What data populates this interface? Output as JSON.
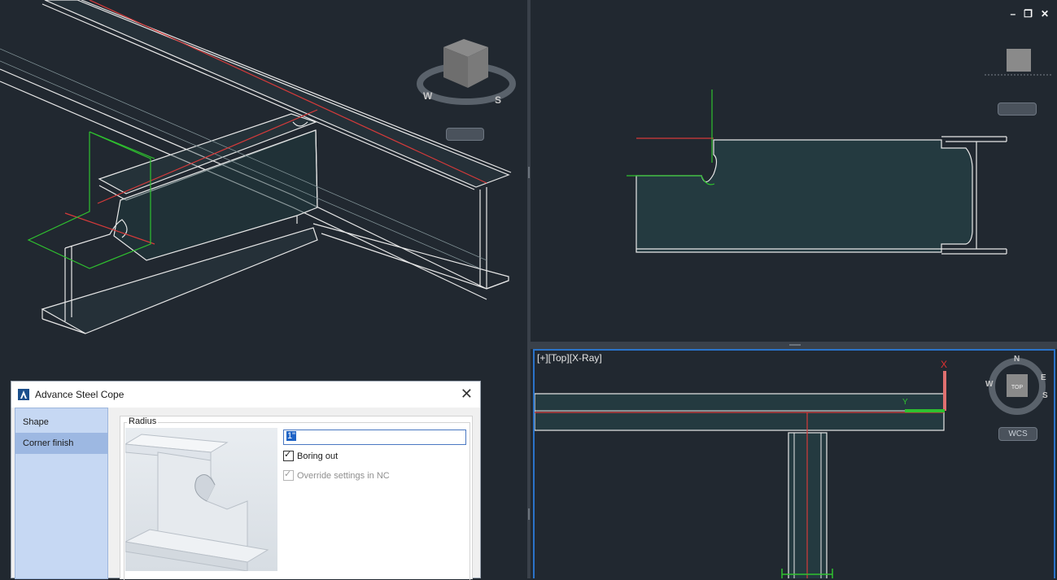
{
  "viewports": {
    "left": {
      "navcube": {
        "compass": [
          "W",
          "S"
        ]
      }
    },
    "right_top": {
      "window_controls": [
        "–",
        "❐",
        "✕"
      ]
    },
    "right_bottom": {
      "label": "[+][Top][X-Ray]",
      "navcube": {
        "face": "TOP",
        "compass": [
          "N",
          "E",
          "S",
          "W"
        ]
      },
      "wcs_label": "WCS",
      "ucs": {
        "x": "X",
        "y": "Y"
      }
    }
  },
  "dialog": {
    "title": "Advance Steel  Cope",
    "close": "✕",
    "nav": [
      "Shape",
      "Corner finish"
    ],
    "active_nav": "Corner finish",
    "group_title": "Radius",
    "radius_value": "1\"",
    "boring_out": {
      "label": "Boring out",
      "checked": true
    },
    "override_nc": {
      "label": "Override settings in NC",
      "checked": true,
      "enabled": false
    }
  },
  "colors": {
    "background": "#212830",
    "active_border": "#2a73c9",
    "x_axis": "#e03131",
    "y_axis": "#2fc12f"
  }
}
